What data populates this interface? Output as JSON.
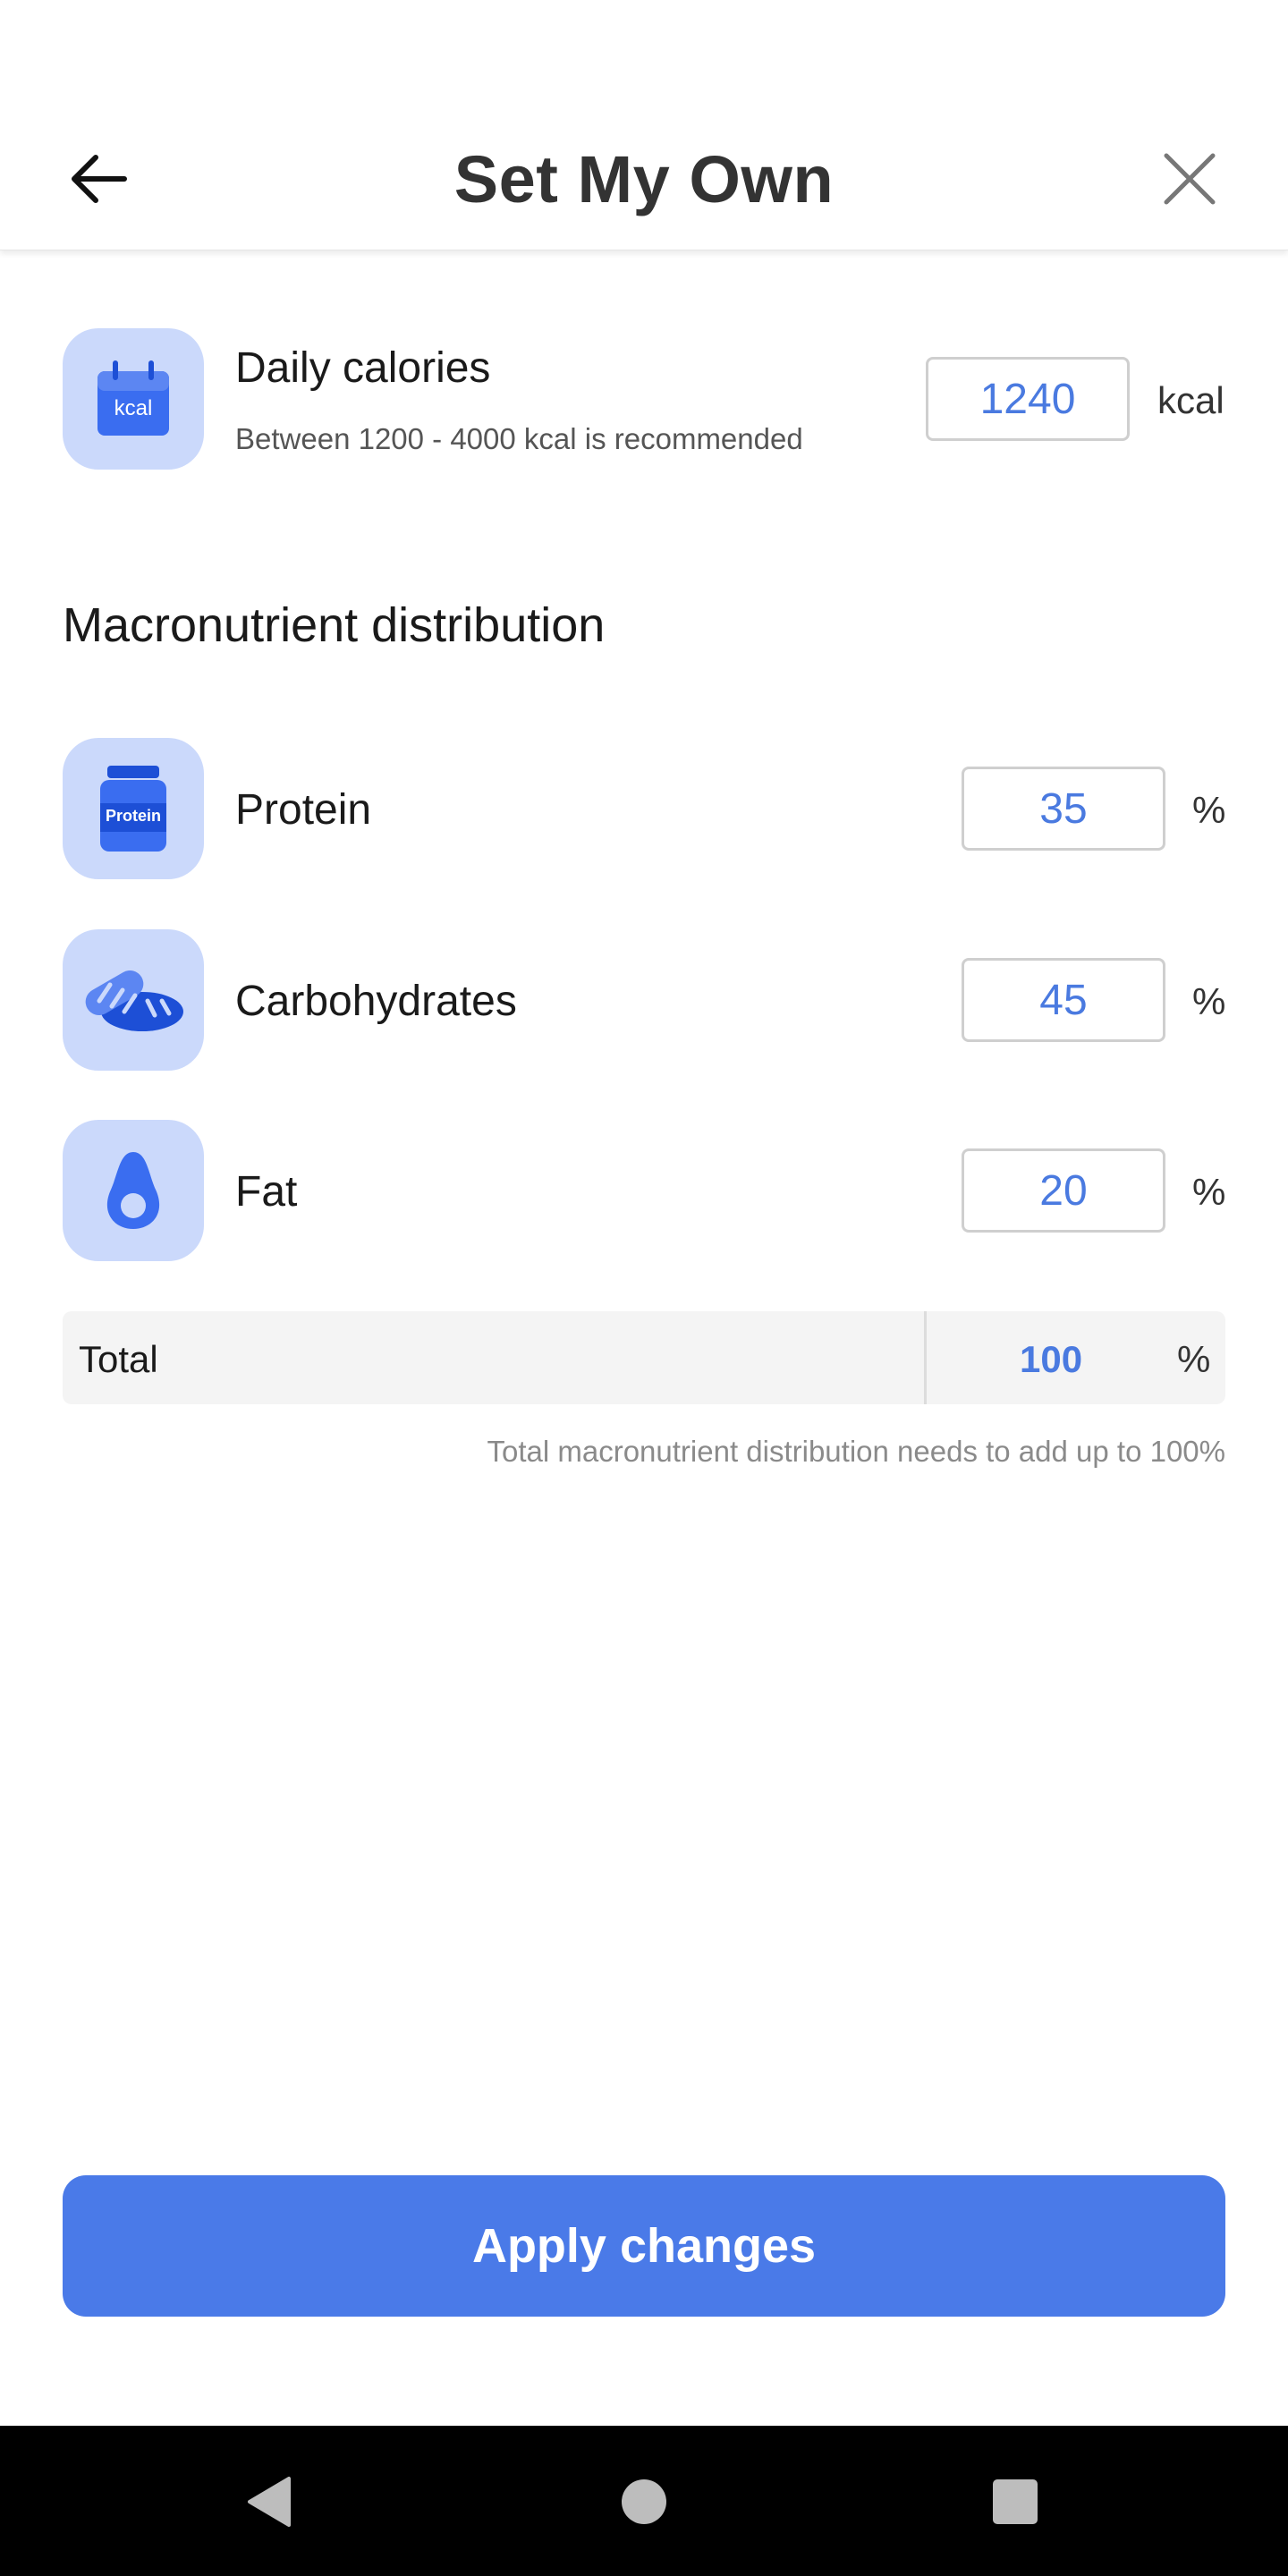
{
  "header": {
    "title": "Set My Own",
    "back_icon": "arrow-left-icon",
    "close_icon": "close-icon"
  },
  "calories": {
    "label": "Daily calories",
    "hint": "Between 1200 - 4000 kcal is recommended",
    "value": "1240",
    "unit": "kcal",
    "icon_text": "kcal",
    "icon": "calendar-kcal-icon"
  },
  "macros": {
    "title": "Macronutrient distribution",
    "items": [
      {
        "label": "Protein",
        "value": "35",
        "unit": "%",
        "icon": "protein-jar-icon",
        "icon_text": "Protein"
      },
      {
        "label": "Carbohydrates",
        "value": "45",
        "unit": "%",
        "icon": "bread-icon"
      },
      {
        "label": "Fat",
        "value": "20",
        "unit": "%",
        "icon": "avocado-icon"
      }
    ],
    "total_label": "Total",
    "total_value": "100",
    "total_unit": "%",
    "total_hint": "Total macronutrient distribution needs to add up to 100%"
  },
  "apply_label": "Apply changes",
  "colors": {
    "accent": "#4a7ae8",
    "icon_bg": "#cbd9fb",
    "input_text": "#4a7ae0"
  }
}
